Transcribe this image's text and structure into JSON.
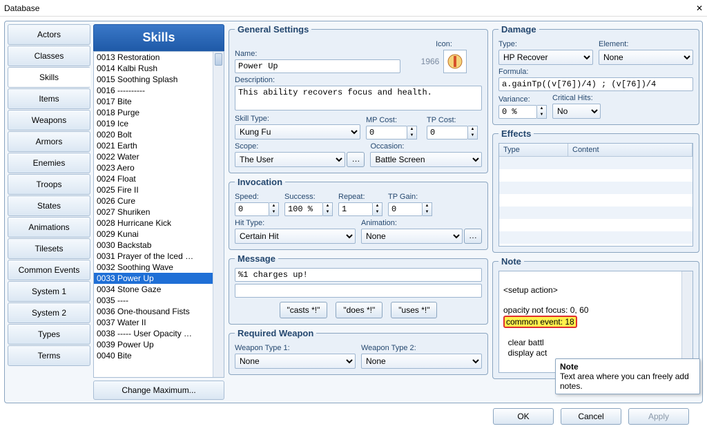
{
  "window": {
    "title": "Database"
  },
  "tabs": [
    "Actors",
    "Classes",
    "Skills",
    "Items",
    "Weapons",
    "Armors",
    "Enemies",
    "Troops",
    "States",
    "Animations",
    "Tilesets",
    "Common Events",
    "System 1",
    "System 2",
    "Types",
    "Terms"
  ],
  "active_tab": "Skills",
  "list_header": "Skills",
  "change_max": "Change Maximum...",
  "skills": [
    {
      "id": "0013",
      "name": "Restoration"
    },
    {
      "id": "0014",
      "name": "Kalbi Rush"
    },
    {
      "id": "0015",
      "name": "Soothing Splash"
    },
    {
      "id": "0016",
      "name": "----------"
    },
    {
      "id": "0017",
      "name": "Bite"
    },
    {
      "id": "0018",
      "name": "Purge"
    },
    {
      "id": "0019",
      "name": "Ice"
    },
    {
      "id": "0020",
      "name": "Bolt"
    },
    {
      "id": "0021",
      "name": "Earth"
    },
    {
      "id": "0022",
      "name": "Water"
    },
    {
      "id": "0023",
      "name": "Aero"
    },
    {
      "id": "0024",
      "name": "Float"
    },
    {
      "id": "0025",
      "name": "Fire II"
    },
    {
      "id": "0026",
      "name": "Cure"
    },
    {
      "id": "0027",
      "name": "Shuriken"
    },
    {
      "id": "0028",
      "name": "Hurricane Kick"
    },
    {
      "id": "0029",
      "name": "Kunai"
    },
    {
      "id": "0030",
      "name": "Backstab"
    },
    {
      "id": "0031",
      "name": "Prayer of the Iced …"
    },
    {
      "id": "0032",
      "name": "Soothing Wave"
    },
    {
      "id": "0033",
      "name": "Power Up"
    },
    {
      "id": "0034",
      "name": "Stone Gaze"
    },
    {
      "id": "0035",
      "name": "----"
    },
    {
      "id": "0036",
      "name": "One-thousand Fists"
    },
    {
      "id": "0037",
      "name": "Water II"
    },
    {
      "id": "0038",
      "name": "----- User Opacity …"
    },
    {
      "id": "0039",
      "name": "Power Up"
    },
    {
      "id": "0040",
      "name": "Bite"
    }
  ],
  "selected_skill_id": "0033",
  "general": {
    "legend": "General Settings",
    "name_lbl": "Name:",
    "name": "Power Up",
    "icon_lbl": "Icon:",
    "icon_id": "1966",
    "desc_lbl": "Description:",
    "desc": "This ability recovers focus and health.",
    "skilltype_lbl": "Skill Type:",
    "skilltype": "Kung Fu",
    "mpcost_lbl": "MP Cost:",
    "mpcost": "0",
    "tpcost_lbl": "TP Cost:",
    "tpcost": "0",
    "scope_lbl": "Scope:",
    "scope": "The User",
    "occasion_lbl": "Occasion:",
    "occasion": "Battle Screen"
  },
  "invocation": {
    "legend": "Invocation",
    "speed_lbl": "Speed:",
    "speed": "0",
    "success_lbl": "Success:",
    "success": "100 %",
    "repeat_lbl": "Repeat:",
    "repeat": "1",
    "tpgain_lbl": "TP Gain:",
    "tpgain": "0",
    "hittype_lbl": "Hit Type:",
    "hittype": "Certain Hit",
    "anim_lbl": "Animation:",
    "anim": "None"
  },
  "message": {
    "legend": "Message",
    "line1": "%1 charges up!",
    "line2": "",
    "btn_casts": "\"casts *!\"",
    "btn_does": "\"does *!\"",
    "btn_uses": "\"uses *!\""
  },
  "reqweapon": {
    "legend": "Required Weapon",
    "t1_lbl": "Weapon Type 1:",
    "t1": "None",
    "t2_lbl": "Weapon Type 2:",
    "t2": "None"
  },
  "damage": {
    "legend": "Damage",
    "type_lbl": "Type:",
    "type": "HP Recover",
    "elem_lbl": "Element:",
    "elem": "None",
    "formula_lbl": "Formula:",
    "formula": "a.gainTp((v[76])/4) ; (v[76])/4",
    "var_lbl": "Variance:",
    "var": "0 %",
    "crit_lbl": "Critical Hits:",
    "crit": "No"
  },
  "effects": {
    "legend": "Effects",
    "col_type": "Type",
    "col_content": "Content"
  },
  "note": {
    "legend": "Note",
    "line_setup": "<setup action>",
    "line_opacity": "opacity not focus: 0, 60",
    "line_common": "common event: 18",
    "line_clear": "  clear battl",
    "line_display": "  display act"
  },
  "tooltip": {
    "title": "Note",
    "body": "Text area where you can freely add notes."
  },
  "buttons": {
    "ok": "OK",
    "cancel": "Cancel",
    "apply": "Apply"
  }
}
